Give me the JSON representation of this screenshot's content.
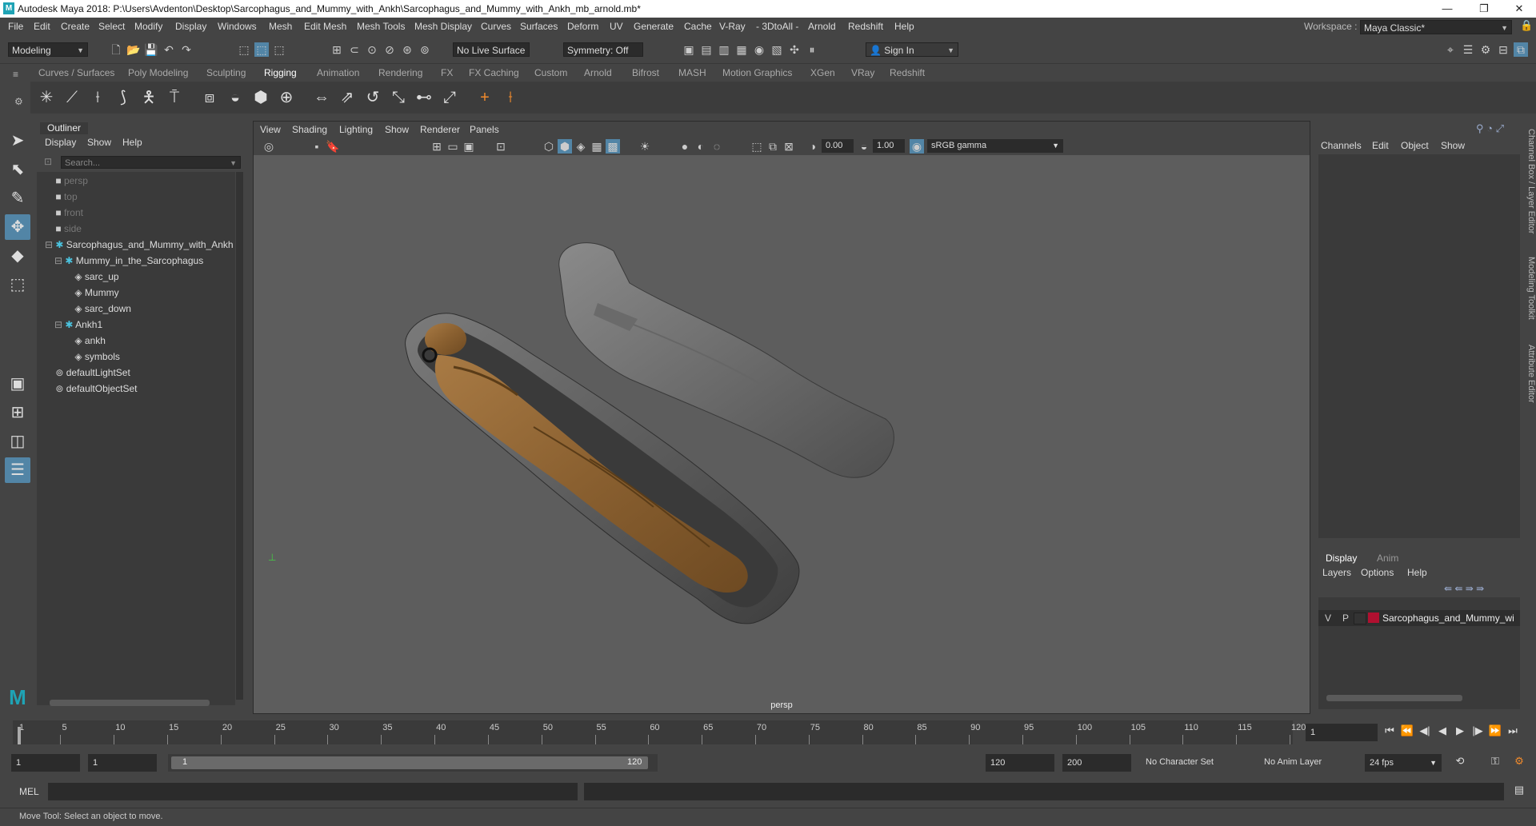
{
  "titlebar": {
    "title": "Autodesk Maya 2018: P:\\Users\\Avdenton\\Desktop\\Sarcophagus_and_Mummy_with_Ankh\\Sarcophagus_and_Mummy_with_Ankh_mb_arnold.mb*",
    "minimize": "—",
    "maximize": "❐",
    "close": "✕"
  },
  "menubar": {
    "items": [
      "File",
      "Edit",
      "Create",
      "Select",
      "Modify",
      "Display",
      "Windows",
      "Mesh",
      "Edit Mesh",
      "Mesh Tools",
      "Mesh Display",
      "Curves",
      "Surfaces",
      "Deform",
      "UV",
      "Generate",
      "Cache",
      "V-Ray",
      "- 3DtoAll -",
      "Arnold",
      "Redshift",
      "Help"
    ],
    "workspace_label": "Workspace :",
    "workspace_value": "Maya Classic*"
  },
  "statusline": {
    "mode": "Modeling",
    "live_surface": "No Live Surface",
    "symmetry": "Symmetry: Off",
    "sign_in": "Sign In"
  },
  "shelf": {
    "tabs": [
      "Curves / Surfaces",
      "Poly Modeling",
      "Sculpting",
      "Rigging",
      "Animation",
      "Rendering",
      "FX",
      "FX Caching",
      "Custom",
      "Arnold",
      "Bifrost",
      "MASH",
      "Motion Graphics",
      "XGen",
      "VRay",
      "Redshift"
    ],
    "active_tab": "Rigging"
  },
  "outliner": {
    "tab": "Outliner",
    "menu": [
      "Display",
      "Show",
      "Help"
    ],
    "search_placeholder": "Search...",
    "items": [
      {
        "label": "persp",
        "depth": 1,
        "type": "camera",
        "dim": true
      },
      {
        "label": "top",
        "depth": 1,
        "type": "camera",
        "dim": true
      },
      {
        "label": "front",
        "depth": 1,
        "type": "camera",
        "dim": true
      },
      {
        "label": "side",
        "depth": 1,
        "type": "camera",
        "dim": true
      },
      {
        "label": "Sarcophagus_and_Mummy_with_Ankh",
        "depth": 1,
        "type": "group",
        "expand": "−",
        "dim": false
      },
      {
        "label": "Mummy_in_the_Sarcophagus",
        "depth": 2,
        "type": "group",
        "expand": "−",
        "dim": false
      },
      {
        "label": "sarc_up",
        "depth": 3,
        "type": "mesh",
        "dim": false
      },
      {
        "label": "Mummy",
        "depth": 3,
        "type": "mesh",
        "dim": false
      },
      {
        "label": "sarc_down",
        "depth": 3,
        "type": "mesh",
        "dim": false
      },
      {
        "label": "Ankh1",
        "depth": 2,
        "type": "group",
        "expand": "−",
        "dim": false
      },
      {
        "label": "ankh",
        "depth": 3,
        "type": "mesh",
        "dim": false
      },
      {
        "label": "symbols",
        "depth": 3,
        "type": "mesh",
        "dim": false
      },
      {
        "label": "defaultLightSet",
        "depth": 1,
        "type": "set",
        "dim": false
      },
      {
        "label": "defaultObjectSet",
        "depth": 1,
        "type": "set",
        "dim": false
      }
    ]
  },
  "viewport": {
    "menu": [
      "View",
      "Shading",
      "Lighting",
      "Show",
      "Renderer",
      "Panels"
    ],
    "exposure": "0.00",
    "gamma": "1.00",
    "color_space": "sRGB gamma",
    "camera_label": "persp"
  },
  "channelbox": {
    "menu": [
      "Channels",
      "Edit",
      "Object",
      "Show"
    ]
  },
  "layer_editor": {
    "tabs": [
      "Display",
      "Anim"
    ],
    "active_tab": "Display",
    "menu": [
      "Layers",
      "Options",
      "Help"
    ],
    "layer": {
      "v": "V",
      "p": "P",
      "name": "Sarcophagus_and_Mummy_wi",
      "color": "#b01030"
    }
  },
  "side_tabs": [
    "Channel Box / Layer Editor",
    "Modeling Toolkit",
    "Attribute Editor"
  ],
  "timeslider": {
    "ticks": [
      "1",
      "5",
      "10",
      "15",
      "20",
      "25",
      "30",
      "35",
      "40",
      "45",
      "50",
      "55",
      "60",
      "65",
      "70",
      "75",
      "80",
      "85",
      "90",
      "95",
      "100",
      "105",
      "110",
      "115",
      "120"
    ],
    "current_frame": "1"
  },
  "range": {
    "start": "1",
    "playback_start": "1",
    "range_start": "1",
    "range_end": "120",
    "playback_end": "120",
    "end": "200",
    "character_set": "No Character Set",
    "anim_layer": "No Anim Layer",
    "fps": "24 fps"
  },
  "cmdline": {
    "label": "MEL"
  },
  "helpline": {
    "text": "Move Tool: Select an object to move."
  },
  "colors": {
    "accent": "#5285a6",
    "panel_bg": "#444444",
    "viewport_bg": "#5d5d5d"
  }
}
